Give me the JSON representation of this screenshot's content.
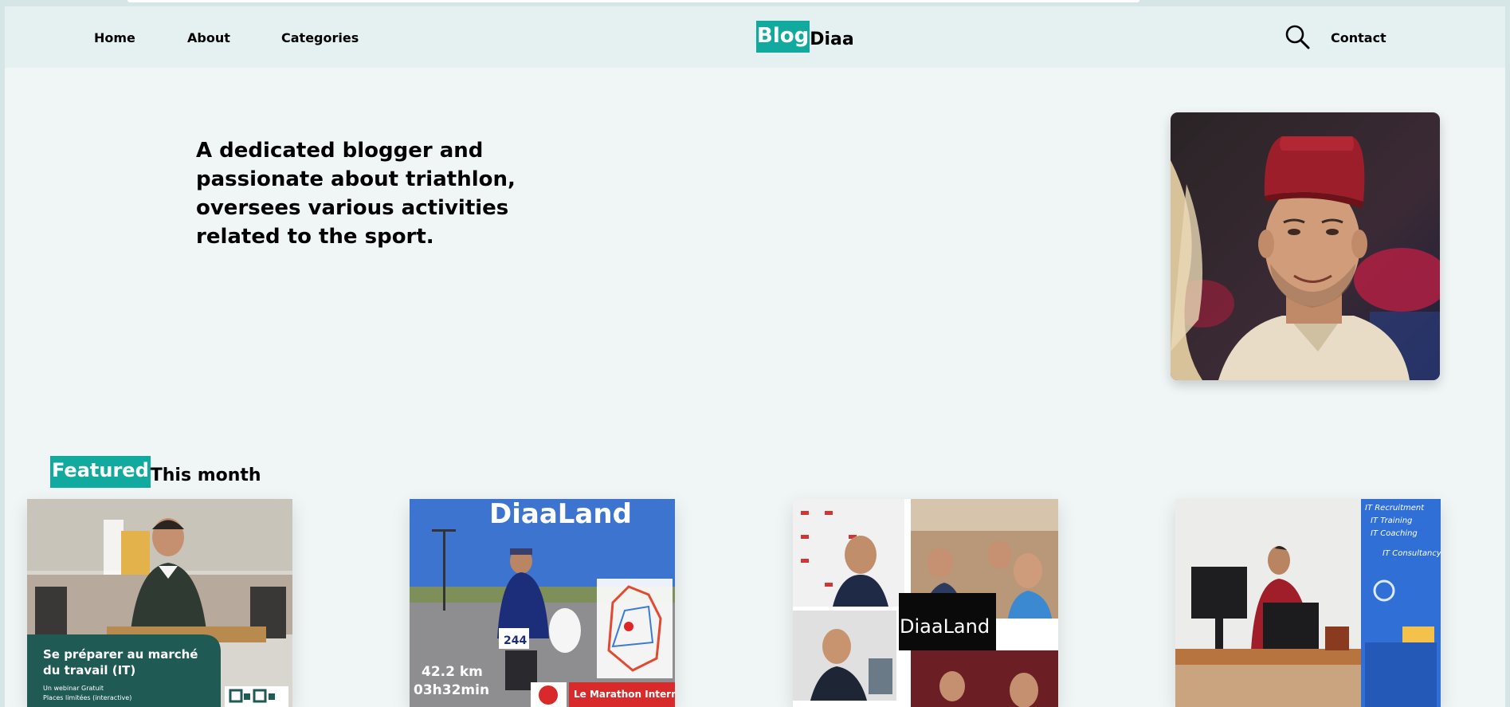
{
  "nav": {
    "links": [
      "Home",
      "About",
      "Categories"
    ],
    "contact": "Contact",
    "logo_part1": "Blog",
    "logo_part2": "Diaa"
  },
  "hero": {
    "text": "A dedicated blogger and passionate about triathlon, oversees various activities related to the sport."
  },
  "featured": {
    "tag": "Featured",
    "rest": "This month",
    "cards": [
      {
        "title": "Se préparer au marché du travail (IT)",
        "line1": "Un webinar Gratuit",
        "line2": "Places limitées (interactive)"
      },
      {
        "brand": "DiaaLand",
        "distance": "42.2 km",
        "time": "03h32min",
        "bib": "244",
        "event": "Le Marathon International"
      },
      {
        "brand": "DiaaLand"
      },
      {
        "services": [
          "IT Recruitment",
          "IT Training",
          "IT Coaching",
          "IT Consultancy"
        ]
      }
    ]
  },
  "colors": {
    "accent": "#12a99f",
    "nav_bg": "#e5f1f1",
    "page_bg": "#f0f6f6"
  }
}
